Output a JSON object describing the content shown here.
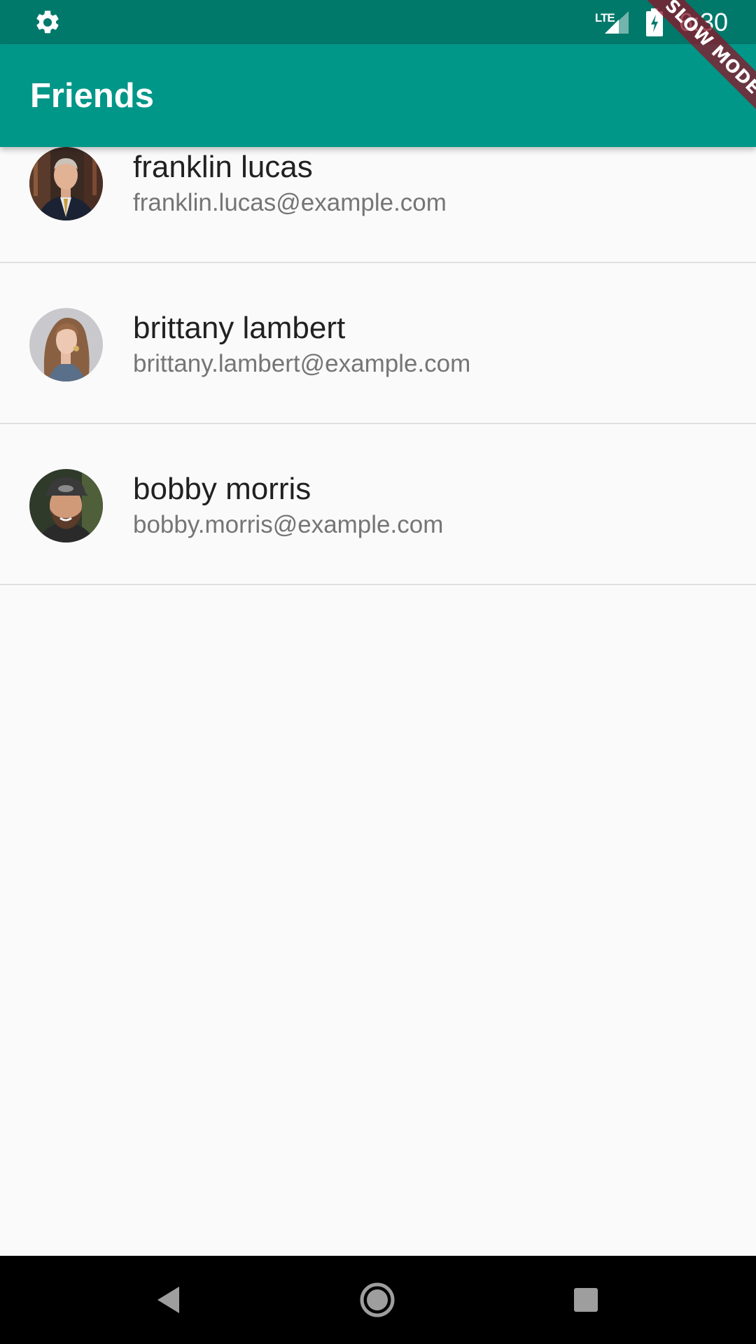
{
  "status_bar": {
    "network": "LTE",
    "time": "6:30",
    "debug_banner": "SLOW MODE",
    "icons": [
      "gear-icon",
      "lte-signal-icon",
      "battery-charging-icon"
    ]
  },
  "app_bar": {
    "title": "Friends"
  },
  "friends": [
    {
      "name": "franklin lucas",
      "email": "franklin.lucas@example.com"
    },
    {
      "name": "brittany lambert",
      "email": "brittany.lambert@example.com"
    },
    {
      "name": "bobby morris",
      "email": "bobby.morris@example.com"
    }
  ],
  "nav_bar": {
    "icons": [
      "back-icon",
      "home-icon",
      "recents-icon"
    ]
  },
  "colors": {
    "primary": "#009688",
    "primary_dark": "#00796b",
    "background": "#fafafa",
    "divider": "#e0e0e0",
    "title_text": "#212121",
    "subtitle_text": "#757575"
  }
}
